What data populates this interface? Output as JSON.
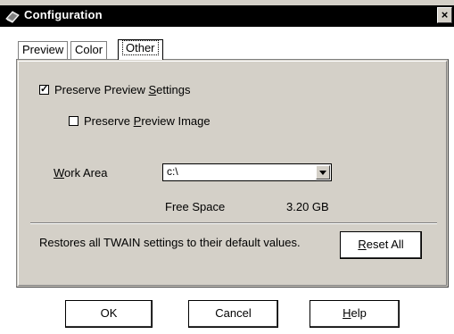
{
  "window": {
    "title": "Configuration",
    "close_label": "×"
  },
  "tabs": [
    {
      "label": "Preview",
      "active": false
    },
    {
      "label": "Color",
      "active": false
    },
    {
      "label": "Other",
      "active": true
    }
  ],
  "other": {
    "preserve_settings": {
      "label_pre": "Preserve Preview ",
      "label_ul": "S",
      "label_post": "ettings",
      "checked": true
    },
    "preserve_image": {
      "label_pre": "Preserve ",
      "label_ul": "P",
      "label_post": "review Image",
      "checked": false
    },
    "work_area": {
      "label_ul": "W",
      "label_post": "ork Area",
      "value": "c:\\"
    },
    "free_space": {
      "label": "Free Space",
      "value": "3.20 GB"
    },
    "reset": {
      "description": "Restores all TWAIN settings to their default values.",
      "button_ul": "R",
      "button_post": "eset All"
    }
  },
  "buttons": {
    "ok": "OK",
    "cancel": "Cancel",
    "help_ul": "H",
    "help_post": "elp"
  },
  "icons": {
    "title": "scanner-icon",
    "dropdown": "chevron-down-icon"
  }
}
